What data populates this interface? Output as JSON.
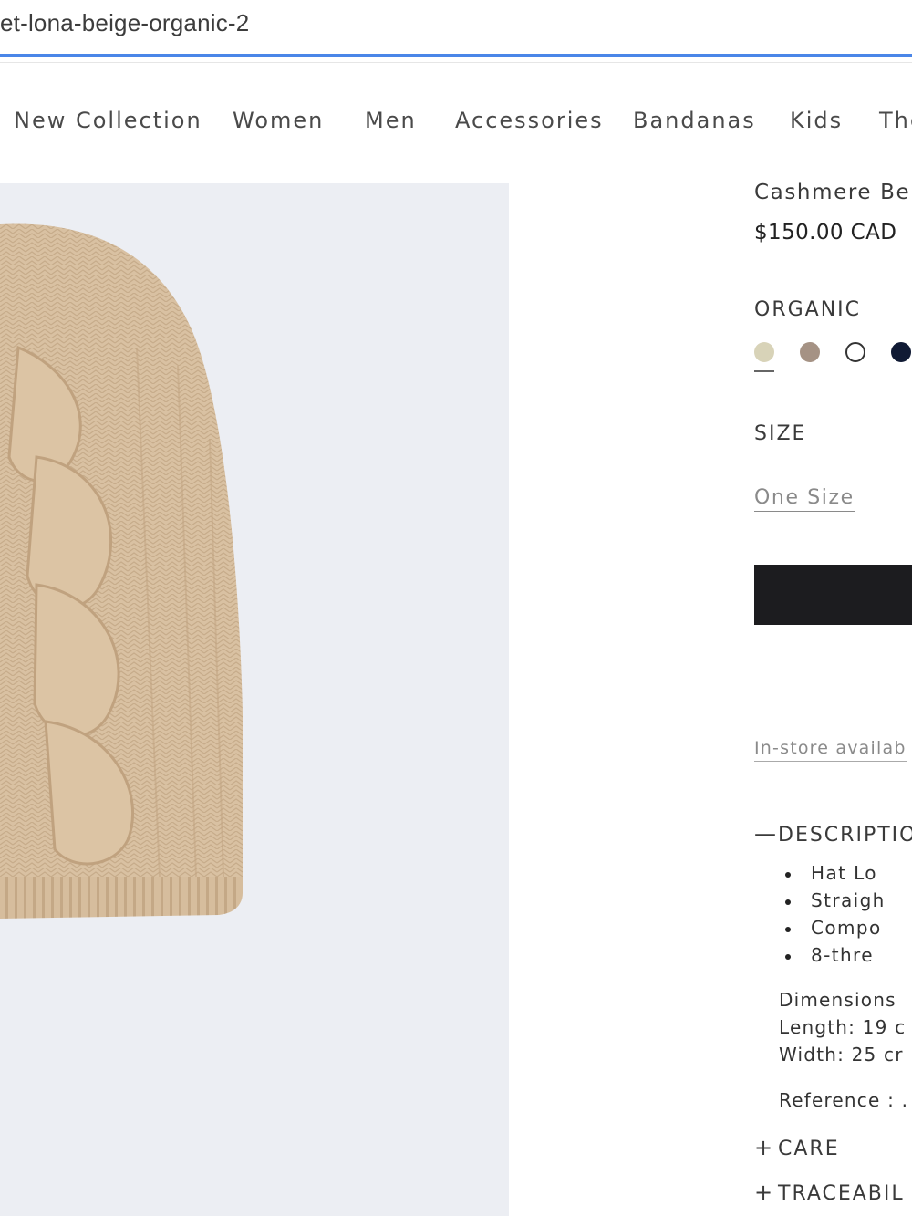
{
  "browser": {
    "url": "et-lona-beige-organic-2"
  },
  "nav": {
    "items": [
      "New Collection",
      "Women",
      "Men",
      "Accessories",
      "Bandanas",
      "Kids",
      "The"
    ]
  },
  "product": {
    "title": "Cashmere Be",
    "price": "$150.00 CAD",
    "color_label": "ORGANIC",
    "swatches": [
      {
        "name": "beige",
        "color": "#d8d3b8"
      },
      {
        "name": "taupe",
        "color": "#a59284"
      },
      {
        "name": "white",
        "color": "#ffffff"
      },
      {
        "name": "navy",
        "color": "#101a34"
      }
    ],
    "size_label": "SIZE",
    "size_option": "One Size",
    "instore": "In-store availab",
    "description": {
      "header": "DESCRIPTIO",
      "sign": "—",
      "bullets": [
        "Hat Lo",
        "Straigh",
        "Compo",
        "8-thre"
      ],
      "dimensions": [
        "Dimensions",
        "Length: 19 c",
        "Width: 25 cr"
      ],
      "reference": "Reference : ."
    },
    "care": {
      "sign": "+",
      "header": "CARE"
    },
    "traceability": {
      "sign": "+",
      "header": "TRACEABIL"
    }
  },
  "colors": {
    "image_bg": "#eceef3",
    "knit": "#d8bf9f",
    "button": "#1c1c1f",
    "url_underline": "#4a86e8"
  }
}
